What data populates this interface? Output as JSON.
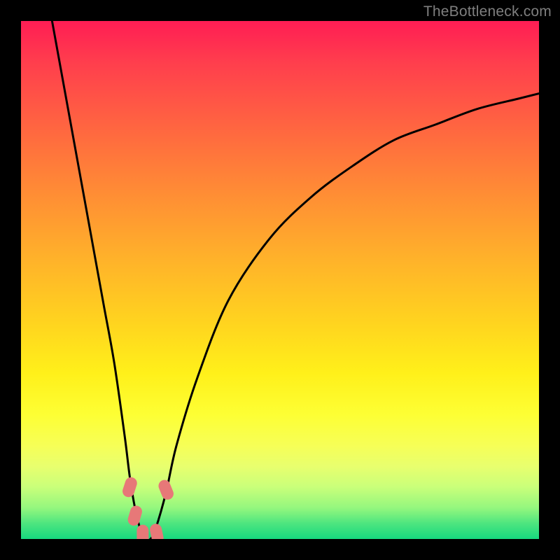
{
  "watermark": "TheBottleneck.com",
  "chart_data": {
    "type": "line",
    "title": "",
    "xlabel": "",
    "ylabel": "",
    "xlim": [
      0,
      100
    ],
    "ylim": [
      0,
      100
    ],
    "grid": false,
    "legend": false,
    "series": [
      {
        "name": "bottleneck-curve",
        "x": [
          6,
          8,
          10,
          12,
          14,
          16,
          18,
          20,
          21,
          22,
          23,
          24,
          25,
          26,
          28,
          30,
          34,
          40,
          48,
          56,
          64,
          72,
          80,
          88,
          96,
          100
        ],
        "y": [
          100,
          89,
          78,
          67,
          56,
          45,
          34,
          20,
          12,
          6,
          2,
          0,
          0,
          2,
          9,
          18,
          31,
          46,
          58,
          66,
          72,
          77,
          80,
          83,
          85,
          86
        ]
      }
    ],
    "markers": [
      {
        "name": "marker-left-upper",
        "x": 21.0,
        "y": 10.0
      },
      {
        "name": "marker-left-lower",
        "x": 22.0,
        "y": 4.5
      },
      {
        "name": "marker-bottom-left",
        "x": 23.5,
        "y": 0.8
      },
      {
        "name": "marker-bottom-right",
        "x": 26.2,
        "y": 1.0
      },
      {
        "name": "marker-right-upper",
        "x": 28.0,
        "y": 9.5
      }
    ],
    "colors": {
      "curve": "#000000",
      "marker_fill": "#e77878",
      "gradient_top": "#ff1d54",
      "gradient_bottom": "#17d97f",
      "background": "#000000",
      "watermark": "#7f7f7f"
    }
  }
}
